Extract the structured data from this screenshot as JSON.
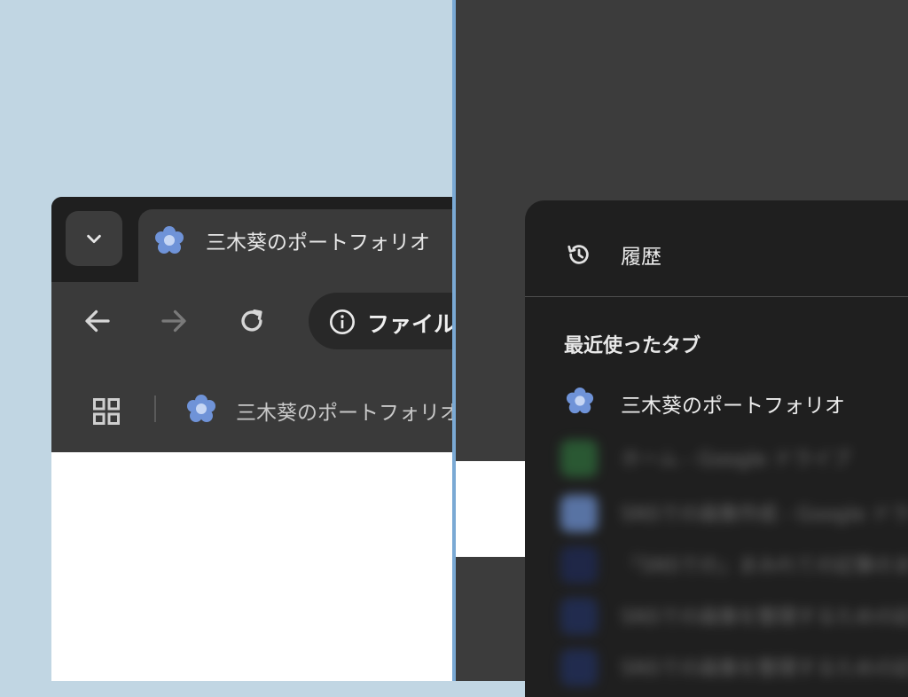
{
  "left_window": {
    "tab": {
      "title": "三木葵のポートフォリオ",
      "favicon": "flower-favicon-icon"
    },
    "toolbar": {
      "back_icon": "arrow-left-icon",
      "forward_icon": "arrow-right-icon",
      "reload_icon": "reload-icon",
      "omnibox_text": "ファイル"
    },
    "bookmarks_bar": {
      "apps_icon": "apps-grid-icon",
      "items": [
        {
          "label": "三木葵のポートフォリオ",
          "favicon": "flower-favicon-icon"
        }
      ]
    }
  },
  "right_window": {
    "menu": {
      "history_label": "履歴",
      "history_icon": "history-icon",
      "recent_tabs_heading": "最近使ったタブ",
      "recent_tabs": [
        {
          "label": "三木葵のポートフォリオ",
          "favicon": "flower-favicon-icon"
        }
      ],
      "blurred_items": [
        {
          "label": "ホーム - Google ドライブ",
          "icon_color": "#2e6b3a"
        },
        {
          "label": "SNSでの画像作成 - Google ドライブ",
          "icon_color": "#6c8fd0"
        },
        {
          "label": "「SNSでの」まみれての記事のまとめ",
          "icon_color": "#1f2a55"
        },
        {
          "label": "SNSでの画像を整理するための記事",
          "icon_color": "#22305e"
        },
        {
          "label": "SNSでの画像を整理するための記事",
          "icon_color": "#22305e"
        }
      ]
    }
  },
  "colors": {
    "desktop_bg": "#c1d6e3",
    "accent_blue": "#7aa9d4",
    "favicon_blue": "#6f93d8"
  }
}
